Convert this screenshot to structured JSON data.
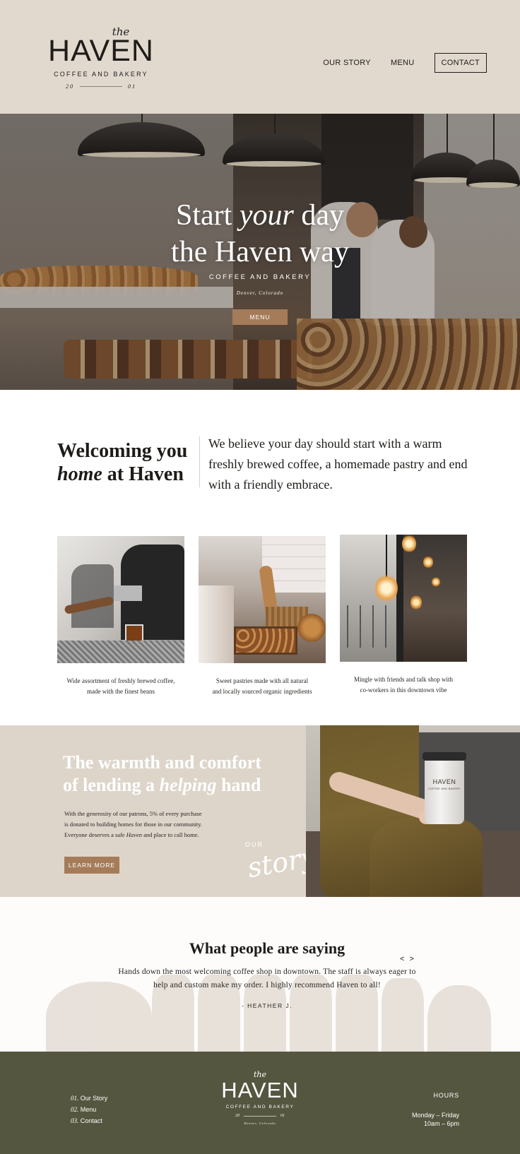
{
  "brand": {
    "the": "the",
    "name": "HAVEN",
    "tagline": "COFFEE AND BAKERY",
    "year_start": "20",
    "year_end": "01",
    "location": "Denver, Colorado"
  },
  "nav": {
    "items": [
      {
        "label": "OUR STORY"
      },
      {
        "label": "MENU"
      },
      {
        "label": "CONTACT"
      }
    ]
  },
  "hero": {
    "title_line1_a": "Start ",
    "title_line1_italic": "your",
    "title_line1_b": " day",
    "title_line2": "the Haven way",
    "subtitle": "COFFEE AND BAKERY",
    "location": "Denver, Colorado",
    "button": "MENU"
  },
  "welcome": {
    "title_line1": "Welcoming you",
    "title_line2_italic": "home",
    "title_line2_rest": " at Haven",
    "text": "We believe your day should start with a warm freshly brewed coffee, a homemade pastry and end with a friendly embrace."
  },
  "features": [
    {
      "line1": "Wide assortment of freshly brewed coffee,",
      "line2": "made with the finest beans"
    },
    {
      "line1": "Sweet pastries made with all natural",
      "line2": "and locally sourced organic ingredients"
    },
    {
      "line1": "Mingle with friends and talk shop with",
      "line2": "co-workers in this downtown vibe"
    }
  ],
  "story": {
    "title_line1": "The warmth and comfort",
    "title_line2_a": "of lending a ",
    "title_line2_italic": "helping",
    "title_line2_b": " hand",
    "text_line1": "With the generosity of our patrons, 5% of every purchase",
    "text_line2": "is donated to building homes for those in our community.",
    "text_line3_a": "Everyone deserves a safe ",
    "text_line3_italic": "Haven",
    "text_line3_b": " and place to call home.",
    "button": "LEARN MORE",
    "script_small": "OUR",
    "script_large": "story",
    "cup_logo": "HAVEN",
    "cup_sub": "COFFEE AND BAKERY"
  },
  "testimonials": {
    "title": "What people are saying",
    "arrows": "< >",
    "quote": "Hands down the most welcoming coffee shop in downtown. The staff is always eager to help and custom make my order. I highly recommend Haven to all!",
    "author": "- HEATHER J."
  },
  "footer": {
    "links": [
      {
        "num": "01.",
        "label": " Our Story"
      },
      {
        "num": "02.",
        "label": " Menu"
      },
      {
        "num": "03.",
        "label": " Contact"
      }
    ],
    "hours_title": "HOURS",
    "hours_days": "Monday – Friday",
    "hours_time": "10am – 6pm"
  },
  "colors": {
    "header_bg": "#e1d9ce",
    "accent_button": "#a57c5a",
    "story_bg": "#ddd5ca",
    "footer_bg": "#55563f",
    "text_dark": "#1e1b18"
  }
}
